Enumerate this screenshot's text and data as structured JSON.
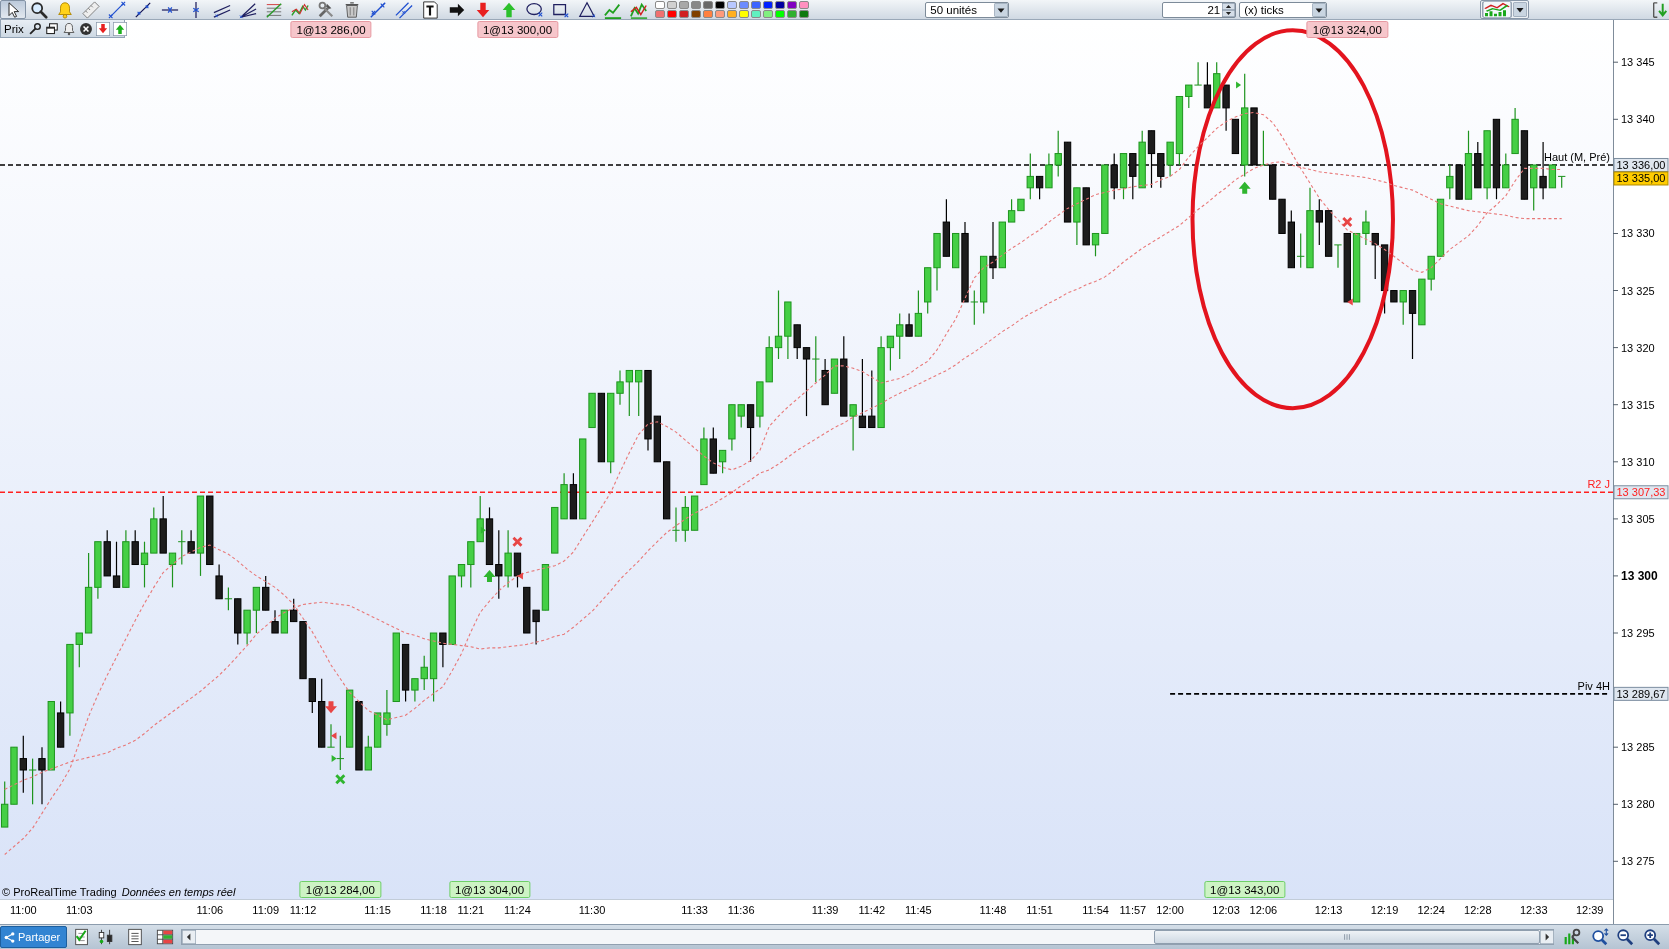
{
  "toolbar": {
    "palette": [
      {
        "color": "#ffffff"
      },
      {
        "color": "#d0d0d0"
      },
      {
        "color": "#a8a8a8"
      },
      {
        "color": "#888888"
      },
      {
        "color": "#686868"
      },
      {
        "color": "#000000"
      },
      {
        "color": "#b8c8ff"
      },
      {
        "color": "#6c8cff"
      },
      {
        "color": "#3c64ff"
      },
      {
        "color": "#0020ff"
      },
      {
        "color": "#0000a0"
      },
      {
        "color": "#8000c0"
      },
      {
        "color": "#ff90c0"
      },
      {
        "color": "#f07070"
      },
      {
        "color": "#ff0000"
      },
      {
        "color": "#d02020"
      },
      {
        "color": "#804000"
      },
      {
        "color": "#ff8040"
      },
      {
        "color": "#ff9a7a"
      },
      {
        "color": "#ffb020"
      },
      {
        "color": "#ffff00"
      },
      {
        "color": "#60f0c0"
      },
      {
        "color": "#80f080"
      },
      {
        "color": "#00ff00"
      },
      {
        "color": "#30b030"
      },
      {
        "color": "#107a10"
      }
    ],
    "quantity": "50 unités",
    "interval": "21",
    "interval_unit": "(x) ticks"
  },
  "chart_header": {
    "title": "Prix"
  },
  "chart": {
    "order_tags": [
      {
        "label": "1@13 286,00",
        "kind": "sell"
      },
      {
        "label": "1@13 300,00",
        "kind": "sell"
      },
      {
        "label": "1@13 324,00",
        "kind": "sell"
      },
      {
        "label": "1@13 284,00",
        "kind": "buy"
      },
      {
        "label": "1@13 304,00",
        "kind": "buy"
      },
      {
        "label": "1@13 343,00",
        "kind": "buy"
      }
    ],
    "source": "© ProRealTime Trading",
    "feed_status": "Données en temps réel",
    "chart_data": [
      {
        "type": "candlestick",
        "categories": [
          null,
          null,
          "11:00",
          null,
          null,
          null,
          null,
          null,
          "11:03",
          null,
          null,
          null,
          null,
          null,
          null,
          null,
          null,
          null,
          null,
          null,
          null,
          null,
          "11:06",
          null,
          null,
          null,
          null,
          null,
          "11:09",
          null,
          null,
          null,
          "11:12",
          null,
          null,
          null,
          null,
          null,
          null,
          null,
          "11:15",
          null,
          null,
          null,
          null,
          null,
          "11:18",
          null,
          null,
          null,
          "11:21",
          null,
          null,
          null,
          null,
          "11:24",
          null,
          null,
          null,
          null,
          null,
          null,
          null,
          "11:30",
          null,
          null,
          null,
          null,
          null,
          null,
          null,
          null,
          null,
          null,
          "11:33",
          null,
          null,
          null,
          null,
          "11:36",
          null,
          null,
          null,
          null,
          null,
          null,
          null,
          null,
          "11:39",
          null,
          null,
          null,
          null,
          "11:42",
          null,
          null,
          null,
          null,
          "11:45",
          null,
          null,
          null,
          null,
          null,
          null,
          null,
          "11:48",
          null,
          null,
          null,
          null,
          "11:51",
          null,
          null,
          null,
          null,
          null,
          "11:54",
          null,
          null,
          null,
          "11:57",
          null,
          null,
          null,
          "12:00",
          null,
          null,
          null,
          null,
          null,
          "12:03",
          null,
          null,
          null,
          "12:06",
          null,
          null,
          null,
          null,
          null,
          null,
          "12:13",
          null,
          null,
          null,
          null,
          null,
          "12:19",
          null,
          null,
          null,
          null,
          "12:24",
          null,
          null,
          null,
          null,
          "12:28",
          null,
          null,
          null,
          null,
          null,
          "12:33",
          null,
          null,
          null,
          null,
          null,
          "12:39",
          null,
          null
        ],
        "ohlc": [
          [
            13278,
            13282,
            13278,
            13280
          ],
          [
            13280,
            13285,
            13280,
            13285
          ],
          [
            13284,
            13286,
            13281,
            13283
          ],
          [
            13283,
            13284,
            13280,
            13283
          ],
          [
            13284,
            13285,
            13280,
            13283
          ],
          [
            13283,
            13289,
            13283,
            13289
          ],
          [
            13288,
            13289,
            13285,
            13285
          ],
          [
            13288,
            13294,
            13286,
            13294
          ],
          [
            13294,
            13295,
            13292,
            13295
          ],
          [
            13295,
            13302,
            13295,
            13299
          ],
          [
            13299,
            13303,
            13298,
            13303
          ],
          [
            13303,
            13304,
            13300,
            13300
          ],
          [
            13300,
            13303,
            13299,
            13299
          ],
          [
            13299,
            13304,
            13299,
            13303
          ],
          [
            13303,
            13304,
            13301,
            13301
          ],
          [
            13301,
            13303,
            13299,
            13302
          ],
          [
            13302,
            13306,
            13302,
            13305
          ],
          [
            13305,
            13307,
            13302,
            13302
          ],
          [
            13301,
            13302,
            13299,
            13302
          ],
          [
            13303,
            13304,
            13301,
            13303
          ],
          [
            13303,
            13304,
            13302,
            13302
          ],
          [
            13302,
            13307,
            13300,
            13307
          ],
          [
            13307,
            13307,
            13301,
            13301
          ],
          [
            13300,
            13301,
            13298,
            13298
          ],
          [
            13298,
            13299,
            13297,
            13298
          ],
          [
            13298,
            13298,
            13294,
            13295
          ],
          [
            13295,
            13297,
            13294,
            13297
          ],
          [
            13297,
            13299,
            13295,
            13299
          ],
          [
            13299,
            13300,
            13297,
            13297
          ],
          [
            13296,
            13297,
            13295,
            13295
          ],
          [
            13295,
            13297,
            13295,
            13297
          ],
          [
            13297,
            13298,
            13296,
            13296
          ],
          [
            13296,
            13296,
            13291,
            13291
          ],
          [
            13291,
            13291,
            13288,
            13289
          ],
          [
            13289,
            13291,
            13285,
            13285
          ],
          [
            13285,
            13287,
            13285,
            13285
          ],
          [
            13284,
            13286,
            13283,
            13284
          ],
          [
            13285,
            13290,
            13285,
            13290
          ],
          [
            13289,
            13289,
            13283,
            13283
          ],
          [
            13283,
            13286,
            13283,
            13285
          ],
          [
            13285,
            13288,
            13285,
            13288
          ],
          [
            13287,
            13290,
            13286,
            13288
          ],
          [
            13289,
            13295,
            13289,
            13295
          ],
          [
            13294,
            13294,
            13289,
            13290
          ],
          [
            13290,
            13291,
            13289,
            13291
          ],
          [
            13291,
            13293,
            13290,
            13292
          ],
          [
            13291,
            13295,
            13289,
            13295
          ],
          [
            13295,
            13295,
            13292,
            13294
          ],
          [
            13294,
            13300,
            13294,
            13300
          ],
          [
            13300,
            13301,
            13299,
            13301
          ],
          [
            13301,
            13303,
            13299,
            13303
          ],
          [
            13303,
            13307,
            13303,
            13305
          ],
          [
            13305,
            13306,
            13301,
            13301
          ],
          [
            13301,
            13304,
            13298,
            13300
          ],
          [
            13300,
            13304,
            13299,
            13302
          ],
          [
            13302,
            13302,
            13299,
            13300
          ],
          [
            13299,
            13299,
            13295,
            13295
          ],
          [
            13297,
            13297,
            13294,
            13296
          ],
          [
            13297,
            13301,
            13297,
            13301
          ],
          [
            13302,
            13306,
            13302,
            13306
          ],
          [
            13305,
            13309,
            13305,
            13308
          ],
          [
            13308,
            13309,
            13305,
            13305
          ],
          [
            13305,
            13312,
            13305,
            13312
          ],
          [
            13313,
            13316,
            13313,
            13316
          ],
          [
            13316,
            13316,
            13310,
            13310
          ],
          [
            13310,
            13316,
            13309,
            13316
          ],
          [
            13316,
            13318,
            13315,
            13317
          ],
          [
            13317,
            13318,
            13314,
            13318
          ],
          [
            13317,
            13318,
            13314,
            13318
          ],
          [
            13318,
            13318,
            13311,
            13312
          ],
          [
            13314,
            13314,
            13310,
            13310
          ],
          [
            13310,
            13310,
            13305,
            13305
          ],
          [
            13304,
            13306,
            13303,
            13304
          ],
          [
            13304,
            13307,
            13303,
            13306
          ],
          [
            13304,
            13307,
            13304,
            13307
          ],
          [
            13308,
            13313,
            13308,
            13312
          ],
          [
            13312,
            13313,
            13309,
            13309
          ],
          [
            13310,
            13311,
            13309,
            13311
          ],
          [
            13312,
            13315,
            13311,
            13315
          ],
          [
            13314,
            13315,
            13313,
            13315
          ],
          [
            13315,
            13315,
            13310,
            13313
          ],
          [
            13314,
            13317,
            13313,
            13317
          ],
          [
            13317,
            13321,
            13317,
            13320
          ],
          [
            13320,
            13325,
            13319,
            13321
          ],
          [
            13321,
            13324,
            13319,
            13324
          ],
          [
            13322,
            13322,
            13319,
            13320
          ],
          [
            13320,
            13320,
            13314,
            13319
          ],
          [
            13319,
            13321,
            13317,
            13319
          ],
          [
            13318,
            13319,
            13315,
            13315
          ],
          [
            13316,
            13319,
            13316,
            13319
          ],
          [
            13319,
            13321,
            13314,
            13314
          ],
          [
            13314,
            13315,
            13311,
            13315
          ],
          [
            13314,
            13319,
            13313,
            13313
          ],
          [
            13314,
            13318,
            13313,
            13313
          ],
          [
            13313,
            13321,
            13313,
            13320
          ],
          [
            13320,
            13321,
            13318,
            13321
          ],
          [
            13321,
            13323,
            13319,
            13322
          ],
          [
            13322,
            13323,
            13321,
            13321
          ],
          [
            13321,
            13325,
            13321,
            13323
          ],
          [
            13324,
            13327,
            13323,
            13327
          ],
          [
            13327,
            13330,
            13325,
            13330
          ],
          [
            13331,
            13333,
            13328,
            13328
          ],
          [
            13327,
            13330,
            13327,
            13330
          ],
          [
            13330,
            13331,
            13324,
            13324
          ],
          [
            13324,
            13325,
            13322,
            13324
          ],
          [
            13324,
            13328,
            13323,
            13328
          ],
          [
            13328,
            13331,
            13326,
            13327
          ],
          [
            13327,
            13331,
            13327,
            13331
          ],
          [
            13331,
            13333,
            13331,
            13332
          ],
          [
            13332,
            13333,
            13332,
            13333
          ],
          [
            13334,
            13337,
            13333,
            13335
          ],
          [
            13335,
            13335,
            13333,
            13334
          ],
          [
            13334,
            13337,
            13334,
            13336
          ],
          [
            13336,
            13339,
            13335,
            13337
          ],
          [
            13338,
            13338,
            13331,
            13331
          ],
          [
            13331,
            13334,
            13329,
            13334
          ],
          [
            13334,
            13334,
            13329,
            13329
          ],
          [
            13329,
            13330,
            13328,
            13330
          ],
          [
            13330,
            13336,
            13330,
            13336
          ],
          [
            13336,
            13337,
            13333,
            13334
          ],
          [
            13334,
            13337,
            13333,
            13337
          ],
          [
            13337,
            13337,
            13333,
            13335
          ],
          [
            13334,
            13339,
            13334,
            13338
          ],
          [
            13339,
            13339,
            13334,
            13337
          ],
          [
            13337,
            13337,
            13334,
            13335
          ],
          [
            13336,
            13338,
            13335,
            13338
          ],
          [
            13337,
            13342,
            13336,
            13342
          ],
          [
            13342,
            13343,
            13341,
            13343
          ],
          [
            13343,
            13345,
            13343,
            13343
          ],
          [
            13343,
            13345,
            13341,
            13341
          ],
          [
            13341,
            13345,
            13341,
            13344
          ],
          [
            13343,
            13343,
            13339,
            13341
          ],
          [
            13340,
            13340,
            13337,
            13337
          ],
          [
            13336,
            13344,
            13335,
            13341
          ],
          [
            13341,
            13341,
            13336,
            13336
          ],
          [
            13336,
            13339,
            13336,
            13336
          ],
          [
            13336,
            13336,
            13333,
            13333
          ],
          [
            13333,
            13333,
            13330,
            13330
          ],
          [
            13331,
            13332,
            13327,
            13327
          ],
          [
            13328,
            13330,
            13327,
            13328
          ],
          [
            13327,
            13334,
            13327,
            13332
          ],
          [
            13332,
            13333,
            13329,
            13331
          ],
          [
            13332,
            13332,
            13328,
            13328
          ],
          [
            13329,
            13329,
            13327,
            13329
          ],
          [
            13330,
            13330,
            13324,
            13324
          ],
          [
            13324,
            13330,
            13324,
            13330
          ],
          [
            13330,
            13332,
            13329,
            13331
          ],
          [
            13330,
            13330,
            13326,
            13329
          ],
          [
            13329,
            13329,
            13323,
            13325
          ],
          [
            13325,
            13325,
            13324,
            13324
          ],
          [
            13324,
            13325,
            13322,
            13325
          ],
          [
            13325,
            13325,
            13319,
            13323
          ],
          [
            13322,
            13326,
            13322,
            13326
          ],
          [
            13326,
            13328,
            13325,
            13328
          ],
          [
            13328,
            13333,
            13328,
            13333
          ],
          [
            13334,
            13336,
            13333,
            13335
          ],
          [
            13336,
            13336,
            13333,
            13333
          ],
          [
            13333,
            13339,
            13333,
            13337
          ],
          [
            13337,
            13338,
            13334,
            13334
          ],
          [
            13334,
            13339,
            13333,
            13339
          ],
          [
            13340,
            13340,
            13333,
            13334
          ],
          [
            13334,
            13337,
            13334,
            13336
          ],
          [
            13337,
            13341,
            13337,
            13340
          ],
          [
            13339,
            13339,
            13333,
            13333
          ],
          [
            13334,
            13336,
            13332,
            13336
          ],
          [
            13335,
            13338,
            13333,
            13334
          ],
          [
            13334,
            13336,
            13334,
            13336
          ],
          [
            13335,
            13335,
            13334,
            13335
          ],
          null,
          null,
          null,
          null,
          null
        ],
        "series": [
          {
            "type": "line",
            "color": "#e87878",
            "line_style": "dashed",
            "values": [
              13275.6,
              13276.3,
              13277.0,
              13277.9,
              13279.2,
              13280.5,
              13281.7,
              13283.1,
              13285.4,
              13287.7,
              13289.6,
              13291.3,
              13292.9,
              13294.5,
              13296.1,
              13297.6,
              13299.0,
              13300.3,
              13301.0,
              13301.7,
              13302.1,
              13302.5,
              13302.7,
              13302.3,
              13301.9,
              13301.3,
              13300.6,
              13300.0,
              13299.5,
              13299.0,
              13298.3,
              13297.5,
              13296.3,
              13295.1,
              13293.7,
              13292.2,
              13291.0,
              13289.8,
              13289.0,
              13288.2,
              13287.8,
              13287.4,
              13287.6,
              13287.8,
              13288.4,
              13289.1,
              13289.7,
              13290.3,
              13291.7,
              13293.2,
              13295.1,
              13296.8,
              13297.8,
              13298.7,
              13299.4,
              13300.0,
              13300.3,
              13300.5,
              13300.7,
              13300.9,
              13301.3,
              13302.1,
              13303.4,
              13304.7,
              13306.0,
              13307.3,
              13309.1,
              13310.8,
              13312.4,
              13313.3,
              13313.5,
              13313.1,
              13312.6,
              13311.9,
              13311.2,
              13310.5,
              13309.9,
              13309.5,
              13309.3,
              13309.6,
              13310.1,
              13311.0,
              13313.1,
              13314.0,
              13314.8,
              13315.5,
              13316.2,
              13316.9,
              13317.6,
              13318.4,
              13318.4,
              13318.2,
              13317.9,
              13317.4,
              13316.9,
              13317.1,
              13317.3,
              13317.7,
              13318.3,
              13318.8,
              13319.8,
              13321.2,
              13322.5,
              13324.3,
              13326.1,
              13327.0,
              13327.5,
              13328.1,
              13328.7,
              13329.2,
              13329.8,
              13330.3,
              13331.0,
              13331.6,
              13332.2,
              13332.6,
              13333.0,
              13333.4,
              13333.6,
              13333.8,
              13333.9,
              13334.1,
              13334.2,
              13334.3,
              13334.7,
              13335.0,
              13335.6,
              13336.7,
              13337.6,
              13338.4,
              13339.2,
              13339.8,
              13340.2,
              13340.5,
              13340.6,
              13340.4,
              13339.7,
              13338.5,
              13337.1,
              13335.7,
              13334.4,
              13333.1,
              13332.1,
              13331.2,
              13330.3,
              13329.9,
              13329.5,
              13329.1,
              13328.6,
              13328.0,
              13327.4,
              13326.8,
              13326.6,
              13327.0,
              13327.8,
              13328.6,
              13329.2,
              13329.8,
              13330.7,
              13331.8,
              13332.5,
              13333.3,
              13334.6,
              13335.7,
              13335.7,
              13335.7,
              13335.6,
              13335.6,
              null,
              null,
              null,
              null,
              null
            ]
          },
          {
            "type": "line",
            "color": "#e87878",
            "line_style": "dashed",
            "values": [
              13281.3,
              13281.7,
              13282.1,
              13282.4,
              13282.8,
              13283.1,
              13283.4,
              13283.7,
              13283.9,
              13284.1,
              13284.3,
              13284.5,
              13284.9,
              13285.2,
              13285.6,
              13286.2,
              13286.9,
              13287.5,
              13288.1,
              13288.7,
              13289.3,
              13289.9,
              13290.6,
              13291.3,
              13292.1,
              13293.0,
              13293.9,
              13294.9,
              13295.6,
              13296.3,
              13296.8,
              13297.2,
              13297.5,
              13297.6,
              13297.7,
              13297.6,
              13297.5,
              13297.4,
              13297.0,
              13296.6,
              13296.2,
              13295.8,
              13295.4,
              13295.0,
              13294.8,
              13294.5,
              13294.3,
              13294.1,
              13294.0,
              13293.9,
              13293.8,
              13293.6,
              13293.7,
              13293.7,
              13293.8,
              13293.9,
              13294.0,
              13294.2,
              13294.4,
              13294.7,
              13294.9,
              13295.5,
              13296.2,
              13296.9,
              13297.8,
              13298.7,
              13299.7,
              13300.5,
              13301.3,
              13302.2,
              13303.0,
              13303.8,
              13304.4,
              13305.0,
              13305.5,
              13305.9,
              13306.3,
              13306.8,
              13307.3,
              13307.9,
              13308.4,
              13309.0,
              13309.3,
              13309.8,
              13310.4,
              13311.0,
              13311.5,
              13312.0,
              13312.5,
              13313.0,
              13313.4,
              13313.9,
              13314.3,
              13314.7,
              13315.1,
              13315.6,
              13316.0,
              13316.4,
              13316.8,
              13317.2,
              13317.6,
              13318.0,
              13318.5,
              13319.1,
              13319.6,
              13320.2,
              13320.8,
              13321.4,
              13321.9,
              13322.5,
              13323.0,
              13323.4,
              13323.9,
              13324.3,
              13324.8,
              13325.1,
              13325.5,
              13325.8,
              13326.2,
              13326.8,
              13327.5,
              13328.1,
              13328.7,
              13329.2,
              13329.7,
              13330.2,
              13330.7,
              13331.4,
              13332.1,
              13332.7,
              13333.4,
              13334.0,
              13334.7,
              13335.2,
              13335.7,
              13336.0,
              13336.2,
              13336.3,
              13336.0,
              13335.8,
              13335.6,
              13335.4,
              13335.3,
              13335.2,
              13335.1,
              13335.0,
              13334.9,
              13334.7,
              13334.5,
              13334.2,
              13334.0,
              13333.8,
              13333.4,
              13333.0,
              13332.6,
              13332.4,
              13332.2,
              13332.0,
              13331.9,
              13331.8,
              13331.7,
              13331.6,
              13331.4,
              13331.3,
              13331.3,
              13331.3,
              13331.3,
              13331.3,
              null,
              null,
              null,
              null,
              null
            ]
          },
          {
            "type": "line",
            "name": "Piv 4H",
            "color": "#000000",
            "line_style": "dashed",
            "values": [
              null,
              null,
              null,
              null,
              null,
              null,
              null,
              null,
              null,
              null,
              null,
              null,
              null,
              null,
              null,
              null,
              null,
              null,
              null,
              null,
              null,
              null,
              null,
              null,
              null,
              null,
              null,
              null,
              null,
              null,
              null,
              null,
              null,
              null,
              null,
              null,
              null,
              null,
              null,
              null,
              null,
              null,
              null,
              null,
              null,
              null,
              null,
              null,
              null,
              null,
              null,
              null,
              null,
              null,
              null,
              null,
              null,
              null,
              null,
              null,
              null,
              null,
              null,
              null,
              null,
              null,
              null,
              null,
              null,
              null,
              null,
              null,
              null,
              null,
              null,
              null,
              null,
              null,
              null,
              null,
              null,
              null,
              null,
              null,
              null,
              null,
              null,
              null,
              null,
              null,
              null,
              null,
              null,
              null,
              null,
              null,
              null,
              null,
              null,
              null,
              null,
              null,
              null,
              null,
              null,
              null,
              null,
              null,
              null,
              null,
              null,
              null,
              null,
              null,
              null,
              null,
              null,
              null,
              null,
              null,
              null,
              null,
              null,
              null,
              null,
              13289.67,
              13289.67,
              13289.67,
              13289.67,
              13289.67,
              13289.67,
              13289.67,
              13289.67,
              13289.67,
              13289.67,
              13289.67,
              13289.67,
              13289.67,
              13289.67,
              13289.67,
              13289.67,
              13289.67,
              13289.67,
              13289.67,
              13289.67,
              13289.67,
              13289.67,
              13289.67,
              13289.67,
              13289.67,
              13289.67,
              13289.67,
              13289.67,
              13289.67,
              13289.67,
              13289.67,
              13289.67,
              13289.67,
              13289.67,
              13289.67,
              13289.67,
              13289.67,
              13289.67,
              13289.67,
              13289.67,
              13289.67,
              13289.67,
              13289.67,
              13289.67,
              13289.67,
              13289.67,
              13289.67,
              13289.67
            ]
          },
          {
            "type": "scatter",
            "marker": "triangle",
            "color": "#e84545",
            "values": [
              null,
              null,
              null,
              null,
              null,
              null,
              null,
              null,
              null,
              null,
              null,
              null,
              null,
              null,
              null,
              null,
              null,
              null,
              null,
              null,
              null,
              null,
              null,
              null,
              null,
              null,
              null,
              null,
              null,
              null,
              null,
              null,
              null,
              null,
              null,
              13286,
              null,
              null,
              null,
              null,
              null,
              null,
              null,
              null,
              null,
              null,
              null,
              null,
              null,
              null,
              null,
              null,
              null,
              null,
              null,
              13300,
              null,
              null,
              null,
              null,
              null,
              null,
              null,
              null,
              null,
              null,
              null,
              null,
              null,
              null,
              null,
              null,
              null,
              null,
              null,
              null,
              null,
              null,
              null,
              null,
              null,
              null,
              null,
              null,
              null,
              null,
              null,
              null,
              null,
              null,
              null,
              null,
              null,
              null,
              null,
              null,
              null,
              null,
              null,
              null,
              null,
              null,
              null,
              null,
              null,
              null,
              null,
              null,
              null,
              null,
              null,
              null,
              null,
              null,
              null,
              null,
              null,
              null,
              null,
              null,
              null,
              null,
              null,
              null,
              null,
              null,
              null,
              null,
              null,
              null,
              null,
              null,
              null,
              null,
              null,
              null,
              null,
              null,
              null,
              null,
              null,
              null,
              null,
              null,
              13324,
              null,
              null,
              null,
              null,
              null,
              null,
              null,
              null,
              null,
              null,
              null,
              null,
              null,
              null,
              null,
              null,
              null,
              null,
              null,
              null,
              null,
              null,
              null,
              null,
              null,
              null,
              null,
              null
            ]
          }
        ],
        "ylim": [
          13271.7,
          13348.7
        ],
        "yticks": [
          {
            "value": 13345,
            "label": "13 345"
          },
          {
            "value": 13340,
            "label": "13 340"
          },
          {
            "value": 13336,
            "label": "13 336,00"
          },
          {
            "value": 13335,
            "label": "13 335,00"
          },
          {
            "value": 13330,
            "label": "13 330"
          },
          {
            "value": 13325,
            "label": "13 325"
          },
          {
            "value": 13320,
            "label": "13 320"
          },
          {
            "value": 13315,
            "label": "13 315"
          },
          {
            "value": 13310,
            "label": "13 310"
          },
          {
            "value": 13307.33,
            "label": "13 307,33"
          },
          {
            "value": 13305,
            "label": "13 305"
          },
          {
            "value": 13300,
            "label": "13 300"
          },
          {
            "value": 13295,
            "label": "13 295"
          },
          {
            "value": 13289.67,
            "label": "13 289,67"
          },
          {
            "value": 13285,
            "label": "13 285"
          },
          {
            "value": 13280,
            "label": "13 280"
          },
          {
            "value": 13275,
            "label": "13 275"
          }
        ],
        "ref_lines": [
          {
            "axis": "y",
            "value": 13336,
            "label": "Haut (M, Pré)",
            "color": "#000000",
            "line_style": "dashed"
          },
          {
            "axis": "y",
            "value": 13307.33,
            "label": "R2 J",
            "color": "#ff2020",
            "line_style": "dashed"
          }
        ]
      }
    ]
  },
  "bottom_bar": {
    "share_button": "Partager"
  }
}
